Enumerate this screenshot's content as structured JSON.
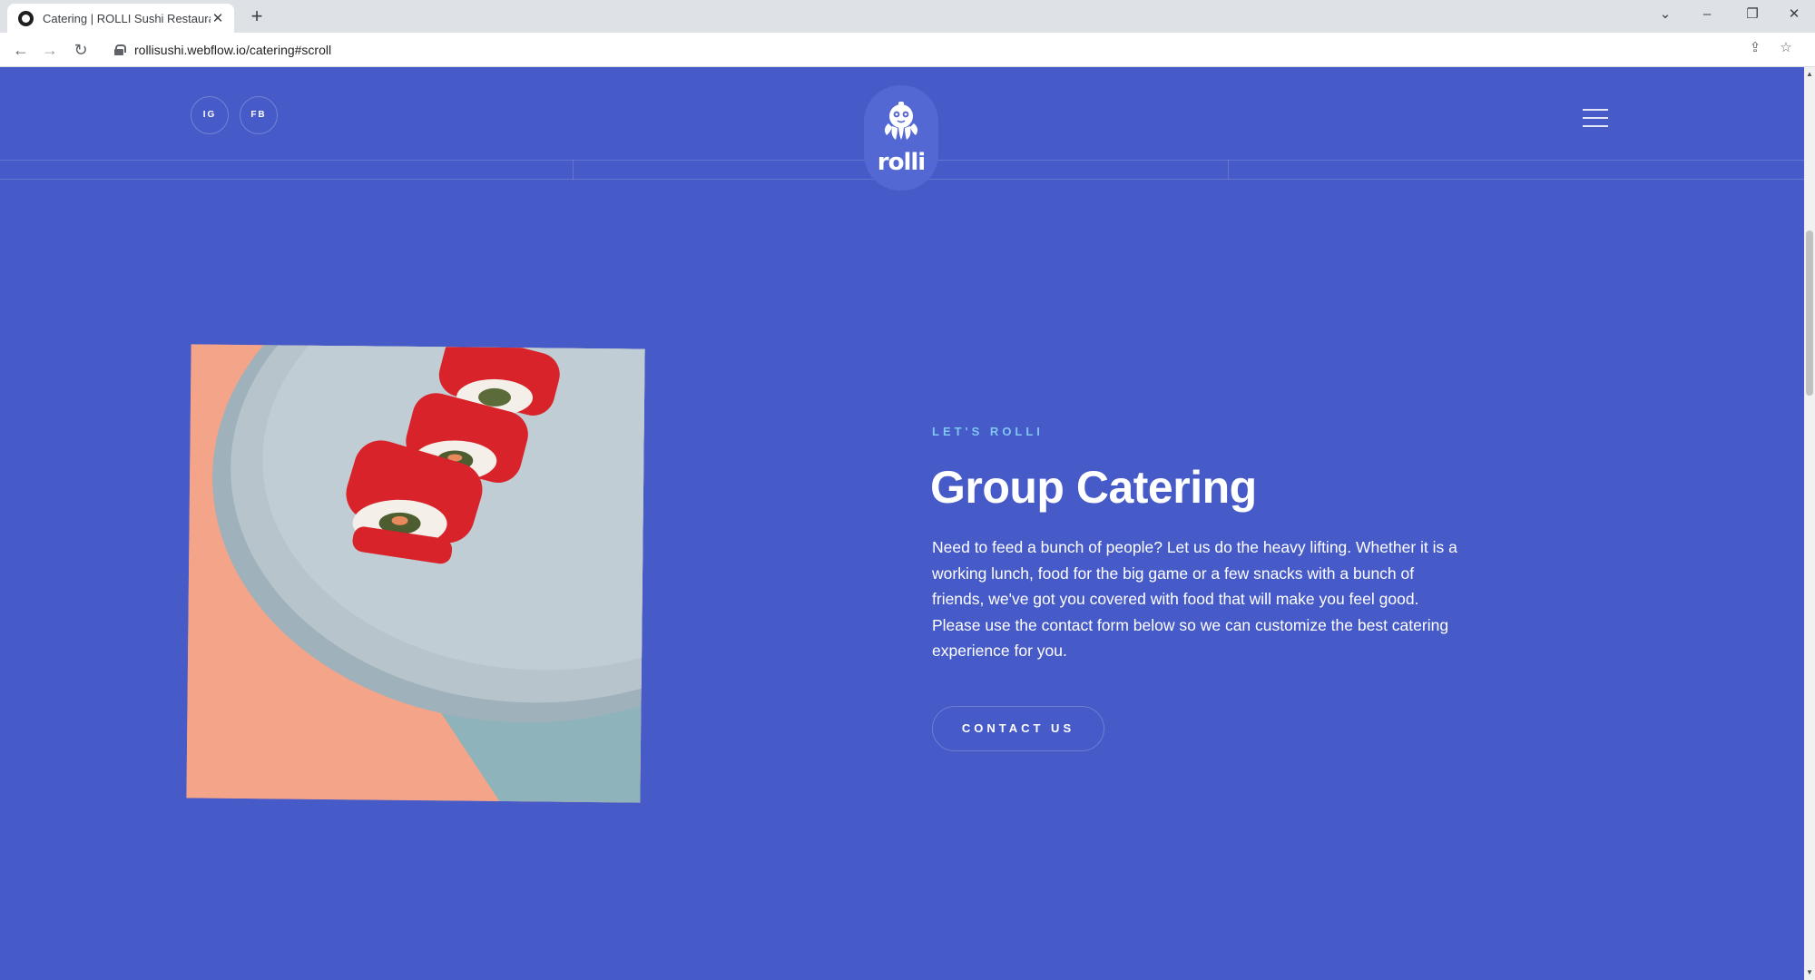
{
  "browser": {
    "tab_title": "Catering | ROLLI Sushi Restaurant",
    "tab_close": "✕",
    "new_tab": "+",
    "url": "rollisushi.webflow.io/catering#scroll",
    "window_controls": [
      "⌄",
      "–",
      "❐",
      "✕"
    ]
  },
  "header": {
    "social": [
      {
        "label": "IG"
      },
      {
        "label": "FB"
      }
    ],
    "logo_text": "rolli"
  },
  "hero": {
    "eyebrow": "LET'S ROLLI",
    "title": "Group Catering",
    "body": "Need to feed a bunch of people? Let us do the heavy lifting. Whether it is a working lunch, food for the big game or a few snacks with a bunch of friends, we've got you covered with food that will make you feel good. Please use the contact form below so we can customize the best catering experience for you.",
    "cta_label": "CONTACT US"
  },
  "colors": {
    "page_bg": "#465ac8",
    "eyebrow": "#7fc6f2",
    "photo_peach": "#f4a489",
    "photo_teal": "#8fb3bb",
    "plate": "#b7c4cc",
    "roe_red": "#d8232a"
  }
}
